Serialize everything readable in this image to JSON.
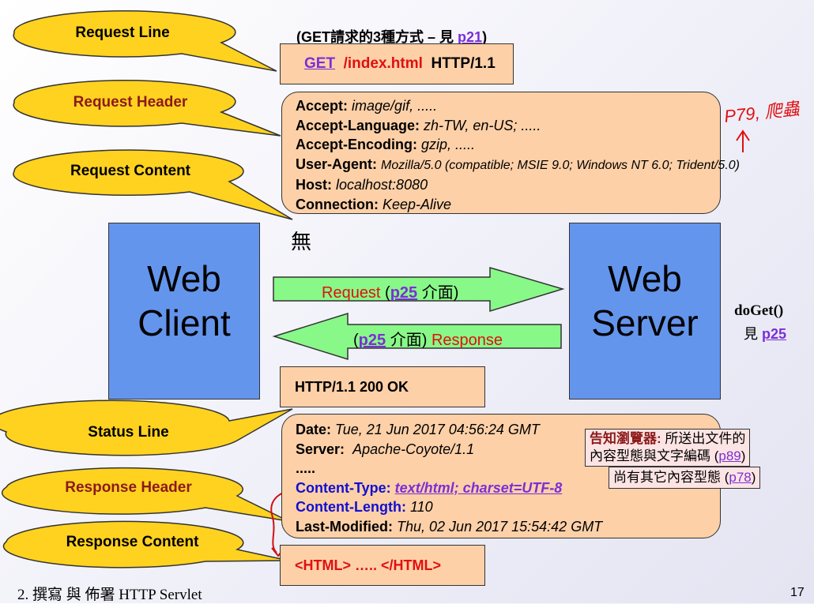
{
  "callouts": {
    "request_line": "Request Line",
    "request_header": "Request Header",
    "request_content": "Request Content",
    "status_line": "Status Line",
    "response_header": "Response Header",
    "response_content": "Response Content"
  },
  "top_note": {
    "prefix": "(GET請求的3種方式 – 見 ",
    "page": "p21",
    "suffix": ")"
  },
  "request_line": {
    "method": "GET",
    "path": "/index.html",
    "protocol": "HTTP/1.1"
  },
  "request_headers": [
    {
      "name": "Accept:",
      "value": "image/gif,  ....."
    },
    {
      "name": "Accept-Language:",
      "value": "zh-TW,  en-US; ....."
    },
    {
      "name": "Accept-Encoding:",
      "value": "gzip,  ....."
    },
    {
      "name": "User-Agent:",
      "value": "Mozilla/5.0 (compatible; MSIE 9.0; Windows NT 6.0; Trident/5.0)"
    },
    {
      "name": "Host:",
      "value": "localhost:8080"
    },
    {
      "name": "Connection:",
      "value": "Keep-Alive"
    }
  ],
  "handwritten_note": "P79, 爬蟲",
  "request_content_value": "無",
  "web_client": {
    "line1": "Web",
    "line2": "Client"
  },
  "web_server": {
    "line1": "Web",
    "line2": "Server"
  },
  "request_arrow": {
    "label": "Request",
    "page": "p25",
    "suffix": "介面)"
  },
  "response_arrow": {
    "page": "p25",
    "suffix": "介面)",
    "label": "Response"
  },
  "doget": {
    "method": "doGet()",
    "see": "見 ",
    "page": "p25"
  },
  "status_line": "HTTP/1.1 200 OK",
  "response_headers": {
    "date_name": "Date:",
    "date_value": "Tue,  21 Jun 2017 04:56:24 GMT",
    "server_name": "Server:",
    "server_value": "Apache-Coyote/1.1",
    "dots": ".....",
    "ctype_name": "Content-Type:",
    "ctype_value": "text/html; charset=UTF-8",
    "clen_name": "Content-Length:",
    "clen_value": "110",
    "lmod_name": "Last-Modified:",
    "lmod_value": "Thu,  02 Jun 2017 15:54:42 GMT"
  },
  "note1": {
    "highlight": "告知瀏覽器:",
    "text1": " 所送出文件的",
    "text2": "內容型態與文字編碼 (",
    "page": "p89",
    "close": ")"
  },
  "note2": {
    "text": "尚有其它內容型態 (",
    "page": "p78",
    "close": ")"
  },
  "response_content": "<HTML> ….. </HTML>",
  "footer": {
    "chapter": "2. 撰寫 與 佈署 HTTP Servlet",
    "page_number": "17"
  }
}
